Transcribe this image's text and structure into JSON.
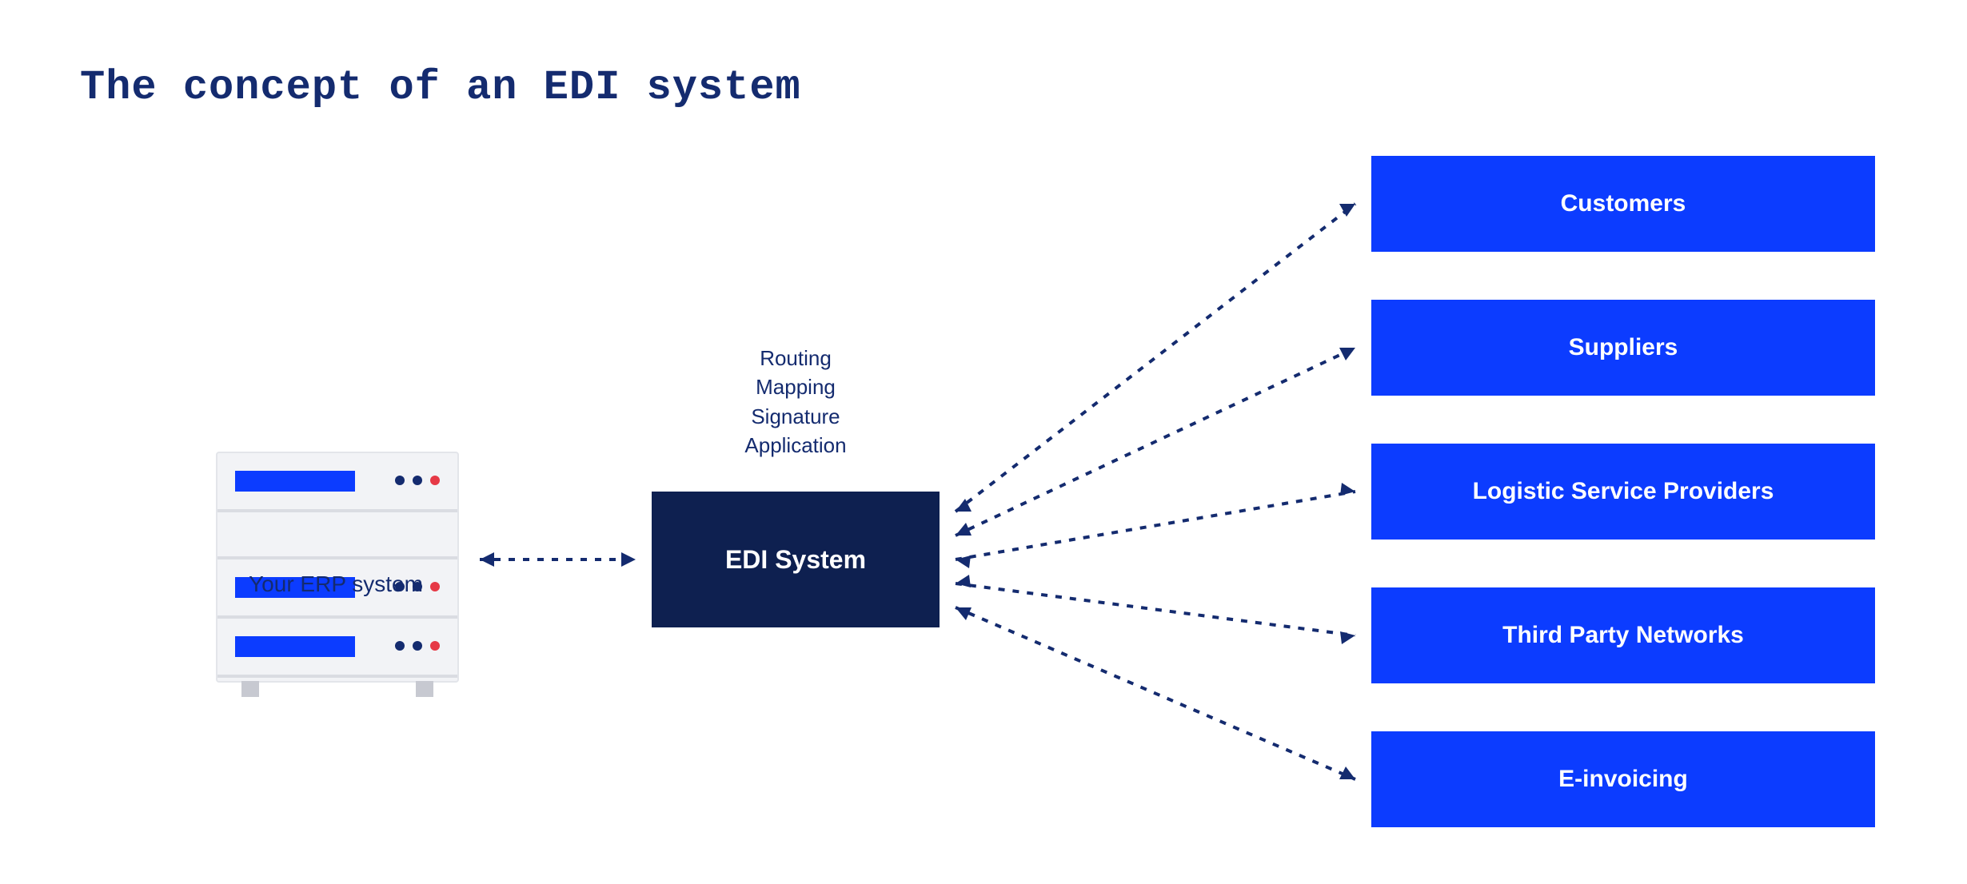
{
  "title": "The concept of an EDI system",
  "erp_label": "Your ERP system",
  "edi_label": "EDI System",
  "edi_meta": [
    "Routing",
    "Mapping",
    "Signature",
    "Application"
  ],
  "partners": [
    "Customers",
    "Suppliers",
    "Logistic Service Providers",
    "Third Party Networks",
    "E-invoicing"
  ],
  "colors": {
    "navy": "#142b6f",
    "dark_navy": "#0e2050",
    "blue": "#0c3cff",
    "red_dot": "#e63946"
  }
}
